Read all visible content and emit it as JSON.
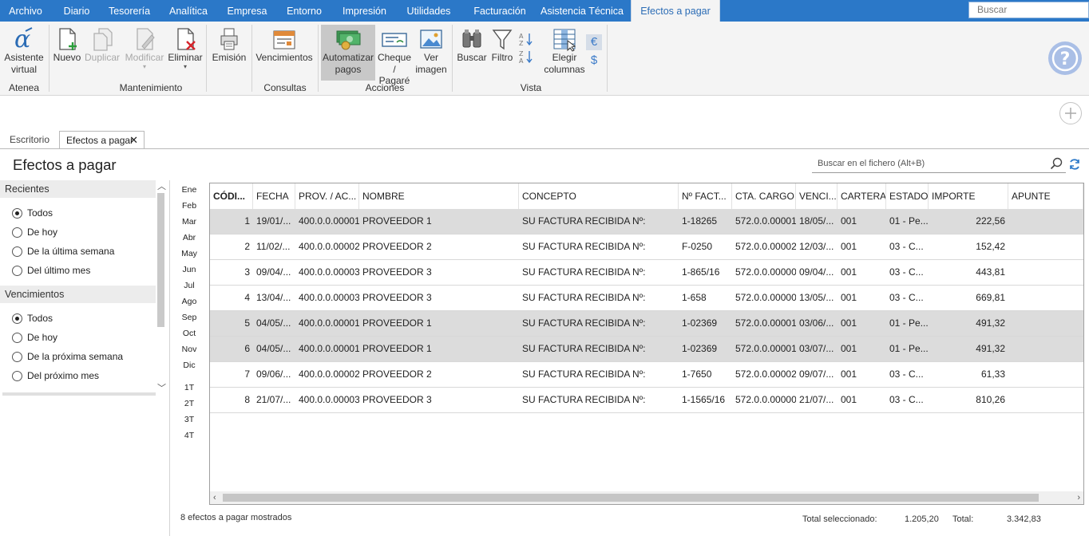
{
  "menu": {
    "tabs": [
      "Archivo",
      "Diario",
      "Tesorería",
      "Analítica",
      "Empresa",
      "Entorno",
      "Impresión",
      "Utilidades",
      "Facturación",
      "Asistencia Técnica",
      "Efectos a pagar"
    ],
    "active_tab": "Efectos a pagar",
    "search_placeholder": "Buscar"
  },
  "ribbon": {
    "buttons": {
      "asistente": [
        "Asistente",
        "virtual"
      ],
      "nuevo": "Nuevo",
      "duplicar": "Duplicar",
      "modificar": "Modificar",
      "eliminar": "Eliminar",
      "emision": "Emisión",
      "vencimientos": "Vencimientos",
      "automatizar": [
        "Automatizar",
        "pagos"
      ],
      "cheque": [
        "Cheque",
        "/ Pagaré"
      ],
      "ver_imagen": [
        "Ver",
        "imagen"
      ],
      "buscar": "Buscar",
      "filtro": "Filtro",
      "elegir": [
        "Elegir",
        "columnas"
      ]
    },
    "groups": {
      "atenea": "Atenea",
      "mantenimiento": "Mantenimiento",
      "consultas": "Consultas",
      "acciones": "Acciones",
      "vista": "Vista"
    }
  },
  "doc_tabs": [
    "Escritorio",
    "Efectos a pagar"
  ],
  "page_title": "Efectos a pagar",
  "file_search_placeholder": "Buscar en el fichero (Alt+B)",
  "filters": {
    "recientes": {
      "title": "Recientes",
      "options": [
        "Todos",
        "De hoy",
        "De la última semana",
        "Del último mes"
      ],
      "selected": "Todos"
    },
    "vencimientos": {
      "title": "Vencimientos",
      "options": [
        "Todos",
        "De hoy",
        "De la próxima semana",
        "Del próximo mes"
      ],
      "selected": "Todos"
    }
  },
  "months": [
    "Ene",
    "Feb",
    "Mar",
    "Abr",
    "May",
    "Jun",
    "Jul",
    "Ago",
    "Sep",
    "Oct",
    "Nov",
    "Dic"
  ],
  "quarters": [
    "1T",
    "2T",
    "3T",
    "4T"
  ],
  "table": {
    "columns": [
      "CÓDI...",
      "FECHA",
      "PROV. / AC...",
      "NOMBRE",
      "CONCEPTO",
      "Nº FACT...",
      "CTA. CARGO",
      "VENCI...",
      "CARTERA",
      "ESTADO",
      "IMPORTE",
      "APUNTE"
    ],
    "rows": [
      {
        "cod": "1",
        "fecha": "19/01/...",
        "prov": "400.0.0.00001",
        "nombre": "PROVEEDOR 1",
        "concepto": "SU FACTURA RECIBIDA Nº:",
        "nfact": "1-18265",
        "cta": "572.0.0.00001",
        "venc": "18/05/...",
        "cartera": "001",
        "estado": "01 - Pe...",
        "importe": "222,56",
        "apunte": "",
        "selected": true
      },
      {
        "cod": "2",
        "fecha": "11/02/...",
        "prov": "400.0.0.00002",
        "nombre": "PROVEEDOR 2",
        "concepto": "SU FACTURA RECIBIDA Nº:",
        "nfact": "F-0250",
        "cta": "572.0.0.00002",
        "venc": "12/03/...",
        "cartera": "001",
        "estado": "03 - C...",
        "importe": "152,42",
        "apunte": "",
        "selected": false
      },
      {
        "cod": "3",
        "fecha": "09/04/...",
        "prov": "400.0.0.00003",
        "nombre": "PROVEEDOR 3",
        "concepto": "SU FACTURA RECIBIDA Nº:",
        "nfact": "1-865/16",
        "cta": "572.0.0.00000",
        "venc": "09/04/...",
        "cartera": "001",
        "estado": "03 - C...",
        "importe": "443,81",
        "apunte": "",
        "selected": false
      },
      {
        "cod": "4",
        "fecha": "13/04/...",
        "prov": "400.0.0.00003",
        "nombre": "PROVEEDOR 3",
        "concepto": "SU FACTURA RECIBIDA Nº:",
        "nfact": "1-658",
        "cta": "572.0.0.00000",
        "venc": "13/05/...",
        "cartera": "001",
        "estado": "03 - C...",
        "importe": "669,81",
        "apunte": "",
        "selected": false
      },
      {
        "cod": "5",
        "fecha": "04/05/...",
        "prov": "400.0.0.00001",
        "nombre": "PROVEEDOR 1",
        "concepto": "SU FACTURA RECIBIDA Nº:",
        "nfact": "1-02369",
        "cta": "572.0.0.00001",
        "venc": "03/06/...",
        "cartera": "001",
        "estado": "01 - Pe...",
        "importe": "491,32",
        "apunte": "",
        "selected": true
      },
      {
        "cod": "6",
        "fecha": "04/05/...",
        "prov": "400.0.0.00001",
        "nombre": "PROVEEDOR 1",
        "concepto": "SU FACTURA RECIBIDA Nº:",
        "nfact": "1-02369",
        "cta": "572.0.0.00001",
        "venc": "03/07/...",
        "cartera": "001",
        "estado": "01 - Pe...",
        "importe": "491,32",
        "apunte": "",
        "selected": true
      },
      {
        "cod": "7",
        "fecha": "09/06/...",
        "prov": "400.0.0.00002",
        "nombre": "PROVEEDOR 2",
        "concepto": "SU FACTURA RECIBIDA Nº:",
        "nfact": "1-7650",
        "cta": "572.0.0.00002",
        "venc": "09/07/...",
        "cartera": "001",
        "estado": "03 - C...",
        "importe": "61,33",
        "apunte": "",
        "selected": false
      },
      {
        "cod": "8",
        "fecha": "21/07/...",
        "prov": "400.0.0.00003",
        "nombre": "PROVEEDOR 3",
        "concepto": "SU FACTURA RECIBIDA Nº:",
        "nfact": "1-1565/16",
        "cta": "572.0.0.00000",
        "venc": "21/07/...",
        "cartera": "001",
        "estado": "03 - C...",
        "importe": "810,26",
        "apunte": "",
        "selected": false
      }
    ]
  },
  "footer": {
    "count_text": "8 efectos a pagar mostrados",
    "total_sel_label": "Total seleccionado:",
    "total_sel_value": "1.205,20",
    "total_label": "Total:",
    "total_value": "3.342,83"
  },
  "colors": {
    "menubar": "#2b78c8",
    "selected_row": "#dcdcdc",
    "accent": "#2b6cb5"
  }
}
